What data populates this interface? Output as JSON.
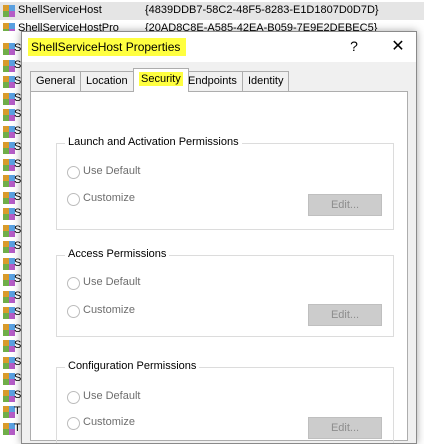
{
  "background_list": {
    "rows": [
      {
        "name": "ShellServiceHost",
        "guid": "{4839DDB7-58C2-48F5-8283-E1D1807D0D7D}"
      },
      {
        "name": "ShellServiceHostPro",
        "guid": "{20AD8C8E-A585-42EA-B059-7E9E2DEBEC5}"
      }
    ],
    "truncated_row_letters": [
      "S",
      "S",
      "S",
      "S",
      "S",
      "S",
      "S",
      "S",
      "S",
      "S",
      "S",
      "S",
      "S",
      "S",
      "S",
      "S",
      "S",
      "S",
      "S",
      "S",
      "S",
      "S",
      "T",
      "T"
    ]
  },
  "dialog": {
    "title": "ShellServiceHost Properties",
    "help_label": "?",
    "close_label": "✕",
    "tabs": [
      {
        "label": "General"
      },
      {
        "label": "Location"
      },
      {
        "label": "Security"
      },
      {
        "label": "Endpoints"
      },
      {
        "label": "Identity"
      }
    ],
    "active_tab": "Security",
    "groups": [
      {
        "title": "Launch and Activation Permissions",
        "use_default": "Use Default",
        "customize": "Customize",
        "edit": "Edit..."
      },
      {
        "title": "Access Permissions",
        "use_default": "Use Default",
        "customize": "Customize",
        "edit": "Edit..."
      },
      {
        "title": "Configuration Permissions",
        "use_default": "Use Default",
        "customize": "Customize",
        "edit": "Edit..."
      }
    ]
  },
  "colors": {
    "highlight": "#ffff40",
    "dialog_bg": "#f0f0f0",
    "disabled_text": "#6d6d6d"
  }
}
